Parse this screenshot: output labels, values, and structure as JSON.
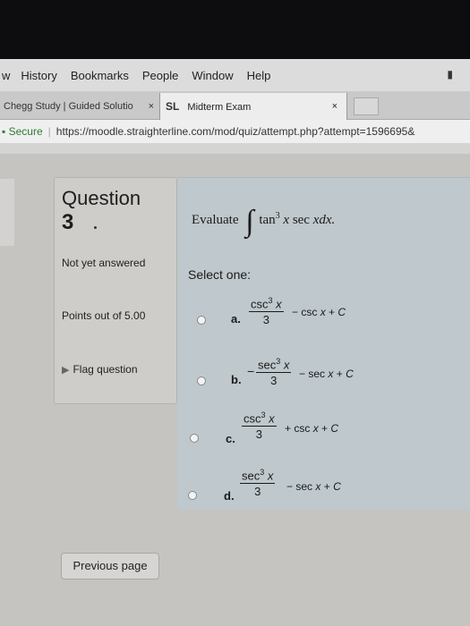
{
  "menubar": {
    "items": [
      "w",
      "History",
      "Bookmarks",
      "People",
      "Window",
      "Help"
    ],
    "battery_icon": "battery-icon"
  },
  "tabs": [
    {
      "label": "Chegg Study | Guided Solutio",
      "close": "×"
    },
    {
      "logo": "SL",
      "label": "Midterm Exam",
      "close": "×"
    }
  ],
  "address": {
    "secure_label": "Secure",
    "url": "https://moodle.straighterline.com/mod/quiz/attempt.php?attempt=1596695&"
  },
  "question_info": {
    "label": "Question",
    "number": "3",
    "state": "Not yet answered",
    "grade": "Points out of 5.00",
    "flag": "Flag question"
  },
  "question": {
    "prompt": "Evaluate",
    "integral_symbol": "∫",
    "func": "tan",
    "power": "3",
    "var_x": "x",
    "sec": "sec",
    "dx": "xdx.",
    "select_one": "Select one:"
  },
  "options": [
    {
      "letter": "a.",
      "sign": "",
      "num_fn": "csc",
      "num_pow": "3",
      "num_var": "x",
      "den": "3",
      "rest_op": "− csc",
      "rest_var": "x",
      "rest_end": "+",
      "rest_c": "C"
    },
    {
      "letter": "b.",
      "sign": "−",
      "num_fn": "sec",
      "num_pow": "3",
      "num_var": "x",
      "den": "3",
      "rest_op": "− sec",
      "rest_var": "x",
      "rest_end": "+",
      "rest_c": "C"
    },
    {
      "letter": "c.",
      "sign": "",
      "num_fn": "csc",
      "num_pow": "3",
      "num_var": "x",
      "den": "3",
      "rest_op": "+ csc",
      "rest_var": "x",
      "rest_end": "+",
      "rest_c": "C"
    },
    {
      "letter": "d.",
      "sign": "",
      "num_fn": "sec",
      "num_pow": "3",
      "num_var": "x",
      "den": "3",
      "rest_op": "− sec",
      "rest_var": "x",
      "rest_end": "+",
      "rest_c": "C"
    }
  ],
  "previous_page": "Previous page"
}
